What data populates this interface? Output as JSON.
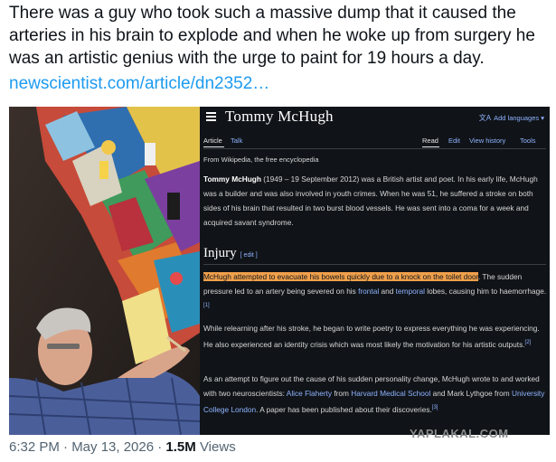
{
  "tweet": {
    "text": "There was a guy who took such a massive dump that it caused the arteries in his brain to explode and when he woke up from surgery he was an artistic genius with the urge to paint for 19 hours a day.",
    "link": "newscientist.com/article/dn2352…",
    "time": "6:32 PM · May 13, 2026 · ",
    "views_count": "1.5M",
    "views_label": " Views"
  },
  "wiki": {
    "title": "Tommy McHugh",
    "add_languages": "Add languages",
    "tabs": {
      "article": "Article",
      "talk": "Talk",
      "read": "Read",
      "edit": "Edit",
      "view_history": "View history",
      "tools": "Tools"
    },
    "from": "From Wikipedia, the free encyclopedia",
    "intro": {
      "name": "Tommy McHugh",
      "rest": " (1949 – 19 September 2012) was a British artist and poet. In his early life, McHugh was a builder and was also involved in youth crimes. When he was 51, he suffered a stroke on both sides of his brain that resulted in two burst blood vessels. He was sent into a coma for a week and acquired savant syndrome."
    },
    "section_title": "Injury",
    "section_edit": "[ edit ]",
    "p1": {
      "highlight": "McHugh attempted to evacuate his bowels quickly due to a knock on the toilet door",
      "a": ". The sudden pressure led to an artery being severed on his ",
      "link1": "frontal",
      "b": " and ",
      "link2": "temporal",
      "c": " lobes, causing him to haemorrhage.",
      "ref": "[1]"
    },
    "p2": {
      "text": "While relearning after his stroke, he began to write poetry to express everything he was experiencing. He also experienced an identity crisis which was most likely the motivation for his artistic outputs.",
      "ref": "[2]"
    },
    "p3": {
      "a": "As an attempt to figure out the cause of his sudden personality change, McHugh wrote to and worked with two neuroscientists: ",
      "link1": "Alice Flaherty",
      "b": " from ",
      "link2": "Harvard Medical School",
      "c": " and Mark Lythgoe from ",
      "link3": "University College London",
      "d": ". A paper has been published about their discoveries.",
      "ref": "[3]"
    }
  },
  "watermark": "YAPLAKAL.COM",
  "colors": {
    "link": "#1d9bf0",
    "wiki_bg": "#101418",
    "wiki_link": "#8fb2ff",
    "highlight": "#f0a04b"
  }
}
